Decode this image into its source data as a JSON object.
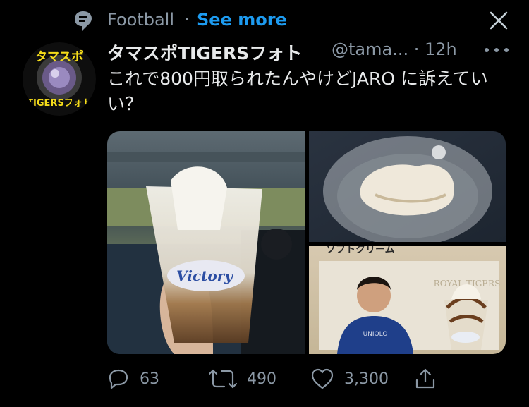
{
  "topic": {
    "label": "Football",
    "separator": "·",
    "see_more": "See more"
  },
  "tweet": {
    "display_name": "タマスポTIGERSフォト",
    "handle_time": "@tama... · 12h",
    "text": "これで800円取られたんやけどJARO に訴えていい？"
  },
  "avatar": {
    "line1": "タマスポ",
    "line2": "TIGERSフォト"
  },
  "media": {
    "cup_brand": "Victory",
    "poster_heading": "ソフトクリーム",
    "poster_brand": "ROYAL TIGERS",
    "hoodie_text": "UNIQLO"
  },
  "actions": {
    "reply_count": "63",
    "retweet_count": "490",
    "like_count": "3,300"
  }
}
